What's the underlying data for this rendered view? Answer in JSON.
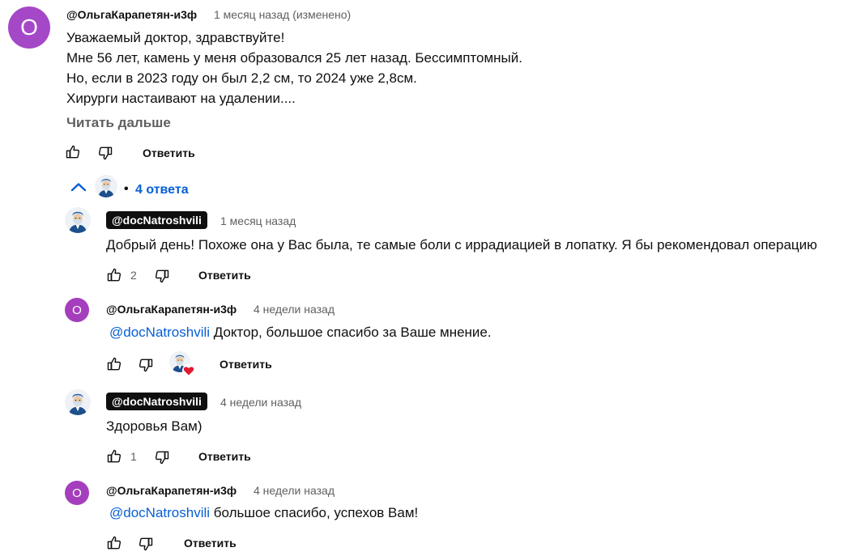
{
  "colors": {
    "avatar_purple": "#a53ebd",
    "avatar_main_purple": "#a548c8",
    "link_blue": "#065fd4",
    "heart_red": "#e0192f"
  },
  "main_comment": {
    "avatar_letter": "О",
    "author": "@ОльгаКарапетян-и3ф",
    "time": "1 месяц назад (изменено)",
    "lines": [
      "Уважаемый доктор, здравствуйте!",
      "Мне 56 лет, камень у меня образовался 25 лет назад. Бессимптомный.",
      "Но, если в 2023 году он был 2,2 см, то 2024 уже 2,8см.",
      "Хирурги настаивают на удалении...."
    ],
    "read_more": "Читать дальше",
    "reply_label": "Ответить"
  },
  "replies_toggle": {
    "bullet": "•",
    "label": "4 ответа"
  },
  "replies": [
    {
      "author": "@docNatroshvili",
      "time": "1 месяц назад",
      "text": "Добрый день! Похоже она у Вас была, те самые боли с иррадиацией в лопатку. Я бы рекомендовал операцию",
      "likes": "2",
      "reply_label": "Ответить"
    },
    {
      "avatar_letter": "О",
      "author": "@ОльгаКарапетян-и3ф",
      "time": "4 недели назад",
      "mention": "@docNatroshvili",
      "text": " Доктор, большое спасибо за Ваше мнение.",
      "reply_label": "Ответить"
    },
    {
      "author": "@docNatroshvili",
      "time": "4 недели назад",
      "text": "Здоровья Вам)",
      "likes": "1",
      "reply_label": "Ответить"
    },
    {
      "avatar_letter": "О",
      "author": "@ОльгаКарапетян-и3ф",
      "time": "4 недели назад",
      "mention": "@docNatroshvili",
      "text": " большое спасибо, успехов Вам!",
      "reply_label": "Ответить"
    }
  ]
}
